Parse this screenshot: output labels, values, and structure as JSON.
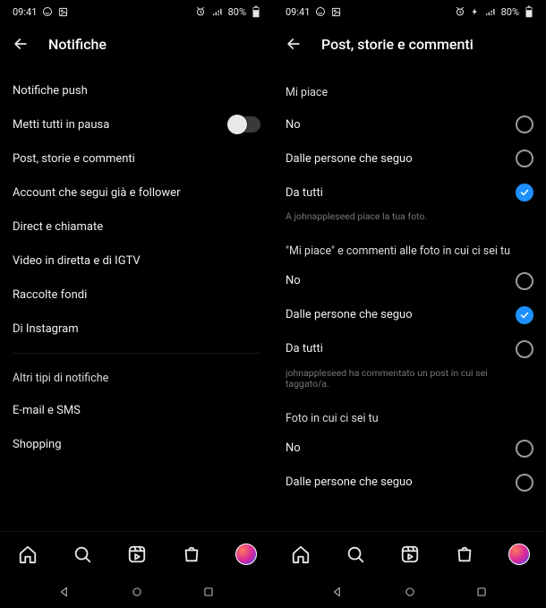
{
  "status": {
    "time": "09:41",
    "battery": "80%"
  },
  "left_screen": {
    "appbar_title": "Notifiche",
    "items": {
      "push": "Notifiche push",
      "pause": "Metti tutti in pausa",
      "posts": "Post, storie e commenti",
      "accounts": "Account che segui già e follower",
      "direct": "Direct e chiamate",
      "video": "Video in diretta e di IGTV",
      "fundraisers": "Raccolte fondi",
      "instagram": "Di Instagram",
      "other_label": "Altri tipi di notifiche",
      "email": "E-mail e SMS",
      "shopping": "Shopping"
    }
  },
  "right_screen": {
    "appbar_title": "Post, storie e commenti",
    "sections": {
      "likes": {
        "label": "Mi piace",
        "no": "No",
        "following": "Dalle persone che seguo",
        "everyone": "Da tutti",
        "example": "A johnappleseed piace la tua foto."
      },
      "likes_comments_tagged": {
        "label": "\"Mi piace\" e commenti alle foto in cui ci sei tu",
        "no": "No",
        "following": "Dalle persone che seguo",
        "everyone": "Da tutti",
        "example": "johnappleseed ha commentato un post in cui sei taggato/a."
      },
      "photos_of_you": {
        "label": "Foto in cui ci sei tu",
        "no": "No",
        "following": "Dalle persone che seguo"
      }
    }
  }
}
